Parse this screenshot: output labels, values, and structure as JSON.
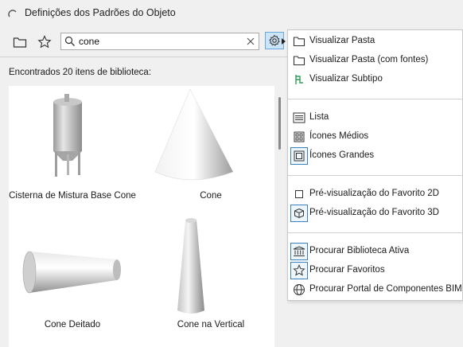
{
  "window": {
    "title": "Definições dos Padrões do Objeto"
  },
  "toolbar": {
    "folder_icon": "folder-icon",
    "favorites_icon": "star-icon",
    "search": {
      "value": "cone",
      "placeholder": ""
    },
    "settings_icon": "gear-icon"
  },
  "results": {
    "found_label": "Encontrados 20 itens de biblioteca:",
    "items": [
      {
        "label": "Cisterna de Mistura Base Cone"
      },
      {
        "label": "Cone"
      },
      {
        "label": "Cone Deitado"
      },
      {
        "label": "Cone na Vertical"
      }
    ]
  },
  "menu": {
    "items": [
      {
        "label": "Visualizar Pasta",
        "icon": "folder-icon"
      },
      {
        "label": "Visualizar Pasta (com fontes)",
        "icon": "folder-icon"
      },
      {
        "label": "Visualizar Subtipo",
        "icon": "subtype-icon"
      },
      {
        "label": "Lista",
        "icon": "list-icon"
      },
      {
        "label": "Ícones Médios",
        "icon": "medium-icons-icon"
      },
      {
        "label": "Ícones Grandes",
        "icon": "large-icons-icon"
      },
      {
        "label": "Pré-visualização do Favorito 2D",
        "icon": "square-2d-icon"
      },
      {
        "label": "Pré-visualização do Favorito 3D",
        "icon": "cube-3d-icon"
      },
      {
        "label": "Procurar Biblioteca Ativa",
        "icon": "library-icon"
      },
      {
        "label": "Procurar Favoritos",
        "icon": "star-icon"
      },
      {
        "label": "Procurar Portal de Componentes BIM",
        "icon": "globe-icon"
      }
    ]
  },
  "colors": {
    "accent": "#3a7fc4",
    "subtype_green": "#2e9b5b",
    "selected_bg": "#cce4f7"
  }
}
